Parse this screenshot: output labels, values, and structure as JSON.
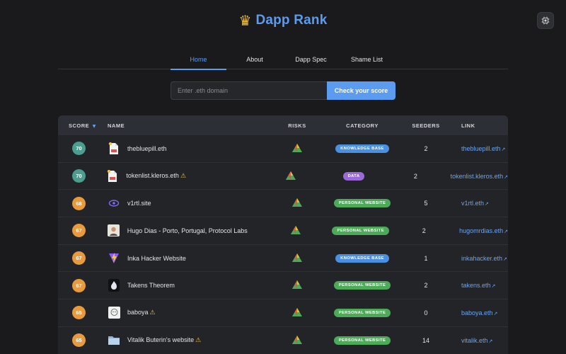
{
  "header": {
    "crown_glyph": "♛",
    "title": "Dapp Rank",
    "settings_icon": "chip-gear-icon"
  },
  "nav": {
    "tabs": [
      {
        "label": "Home",
        "active": true
      },
      {
        "label": "About",
        "active": false
      },
      {
        "label": "Dapp Spec",
        "active": false
      },
      {
        "label": "Shame List",
        "active": false
      }
    ]
  },
  "search": {
    "value": "",
    "placeholder": "Enter .eth domain",
    "button_label": "Check your score"
  },
  "table": {
    "headers": {
      "score": "SCORE",
      "sort_indicator": "▼",
      "name": "NAME",
      "risks": "RISKS",
      "category": "CATEGORY",
      "seeders": "SEEDERS",
      "link": "LINK"
    },
    "link_arrow": "↗",
    "warning_glyph": "⚠",
    "rows": [
      {
        "score": "70",
        "score_color": "#4a9d8f",
        "icon": "document-icon",
        "name": "thebluepill.eth",
        "warning": false,
        "category": "KNOWLEDGE BASE",
        "category_color": "#4a8fe0",
        "seeders": "2",
        "link": "thebluepill.eth"
      },
      {
        "score": "70",
        "score_color": "#4a9d8f",
        "icon": "document-icon",
        "name": "tokenlist.kleros.eth",
        "warning": true,
        "category": "DATA",
        "category_color": "#9b6ad8",
        "seeders": "2",
        "link": "tokenlist.kleros.eth"
      },
      {
        "score": "68",
        "score_color": "#e89a3c",
        "icon": "eye-logo-icon",
        "name": "v1rtl.site",
        "warning": false,
        "category": "PERSONAL WEBSITE",
        "category_color": "#4caa58",
        "seeders": "5",
        "link": "v1rtl.eth"
      },
      {
        "score": "67",
        "score_color": "#e89a3c",
        "icon": "avatar-icon",
        "name": "Hugo Dias - Porto, Portugal, Protocol Labs",
        "warning": false,
        "category": "PERSONAL WEBSITE",
        "category_color": "#4caa58",
        "seeders": "2",
        "link": "hugomrdias.eth"
      },
      {
        "score": "67",
        "score_color": "#e89a3c",
        "icon": "vite-logo-icon",
        "name": "Inka Hacker Website",
        "warning": false,
        "category": "KNOWLEDGE BASE",
        "category_color": "#4a8fe0",
        "seeders": "1",
        "link": "inkahacker.eth"
      },
      {
        "score": "67",
        "score_color": "#e89a3c",
        "icon": "flame-logo-icon",
        "name": "Takens Theorem",
        "warning": false,
        "category": "PERSONAL WEBSITE",
        "category_color": "#4caa58",
        "seeders": "2",
        "link": "takens.eth"
      },
      {
        "score": "65",
        "score_color": "#e89a3c",
        "icon": "sketch-avatar-icon",
        "name": "baboya",
        "warning": true,
        "category": "PERSONAL WEBSITE",
        "category_color": "#4caa58",
        "seeders": "0",
        "link": "baboya.eth"
      },
      {
        "score": "65",
        "score_color": "#e89a3c",
        "icon": "folder-icon",
        "name": "Vitalik Buterin's website",
        "warning": true,
        "category": "PERSONAL WEBSITE",
        "category_color": "#4caa58",
        "seeders": "14",
        "link": "vitalik.eth"
      }
    ]
  }
}
